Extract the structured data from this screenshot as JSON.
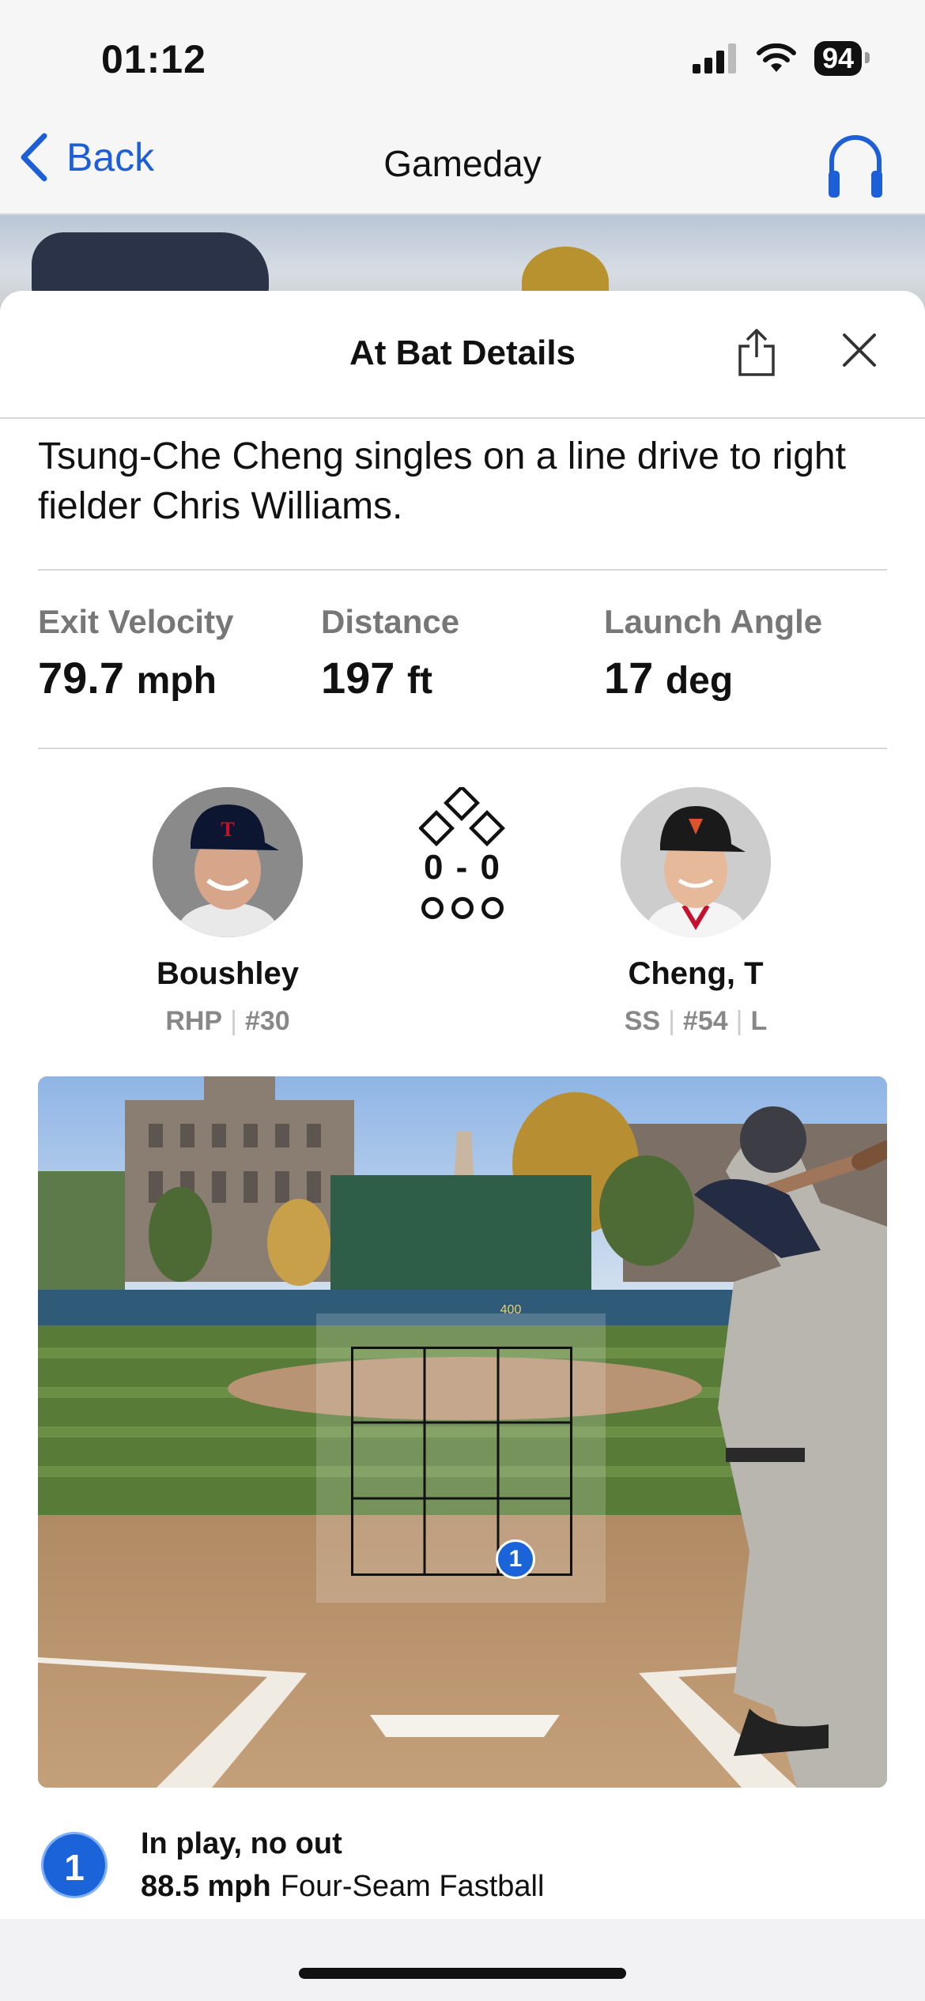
{
  "status_bar": {
    "time": "01:12",
    "battery": "94"
  },
  "nav": {
    "back_label": "Back",
    "title": "Gameday"
  },
  "sheet": {
    "title": "At Bat Details"
  },
  "play": {
    "description": "Tsung-Che Cheng singles on a line drive to right fielder Chris Williams."
  },
  "stats": [
    {
      "label": "Exit Velocity",
      "value": "79.7",
      "unit": "mph"
    },
    {
      "label": "Distance",
      "value": "197",
      "unit": "ft"
    },
    {
      "label": "Launch Angle",
      "value": "17",
      "unit": "deg"
    }
  ],
  "pitcher": {
    "name": "Boushley",
    "position": "RHP",
    "number": "#30"
  },
  "batter": {
    "name": "Cheng, T",
    "position": "SS",
    "number": "#54",
    "bats": "L"
  },
  "count": "0 - 0",
  "outfield": {
    "fence_distance": "400"
  },
  "pitches": [
    {
      "number": "1",
      "result": "In play, no out",
      "speed": "88.5 mph",
      "type": "Four-Seam Fastball"
    }
  ],
  "colors": {
    "accent": "#1d5fd6",
    "pitch_badge": "#1a63d8"
  }
}
